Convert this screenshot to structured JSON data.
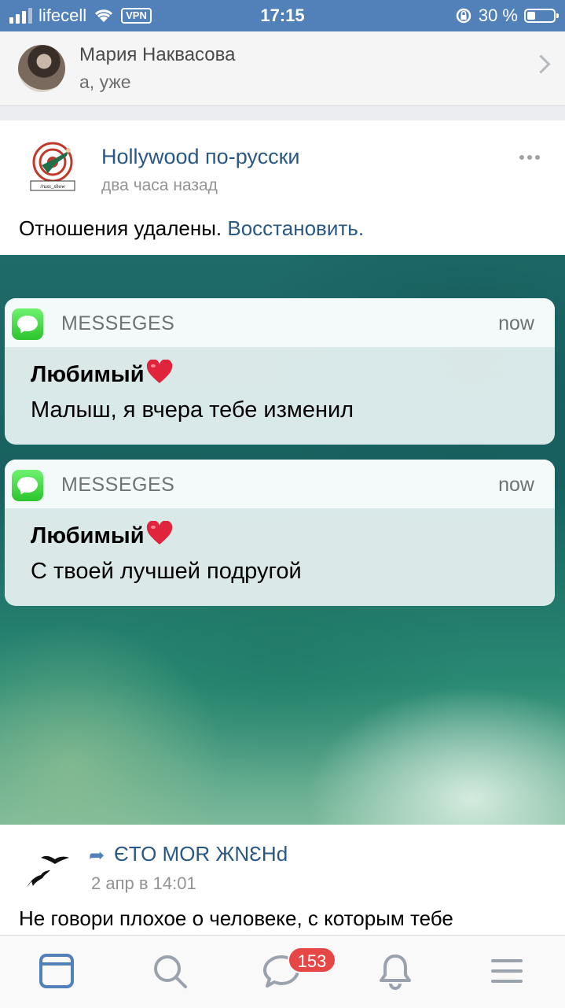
{
  "status_bar": {
    "carrier": "lifecell",
    "vpn": "VPN",
    "time": "17:15",
    "battery": "30 %",
    "battery_level": 0.3
  },
  "message_header": {
    "name": "Мария Наквасова",
    "preview": "а, уже"
  },
  "post": {
    "group_name": "Hollywood по-русски",
    "logo_caption": "/russ_show",
    "time": "два часа назад",
    "status_text": "Отношения удалены.",
    "restore_label": "Восстановить.",
    "notifications": [
      {
        "app": "MESSEGES",
        "time": "now",
        "sender": "Любимый",
        "body": "Малыш, я вчера тебе изменил"
      },
      {
        "app": "MESSEGES",
        "time": "now",
        "sender": "Любимый",
        "body": "С твоей лучшей подругой"
      }
    ]
  },
  "post2": {
    "group_name": "ЄTO MOR ЖNƐHd",
    "time": "2 апр в 14:01",
    "text": "Не говори плохое о человеке, с которым тебе"
  },
  "tabbar": {
    "items": [
      {
        "icon": "news-icon",
        "active": true
      },
      {
        "icon": "search-icon",
        "active": false
      },
      {
        "icon": "messages-icon",
        "active": false
      },
      {
        "icon": "bell-icon",
        "active": false
      },
      {
        "icon": "menu-icon",
        "active": false
      }
    ],
    "messages_badge": "153"
  },
  "colors": {
    "accent": "#5181b8",
    "link": "#2a5885",
    "badge": "#e64646"
  }
}
